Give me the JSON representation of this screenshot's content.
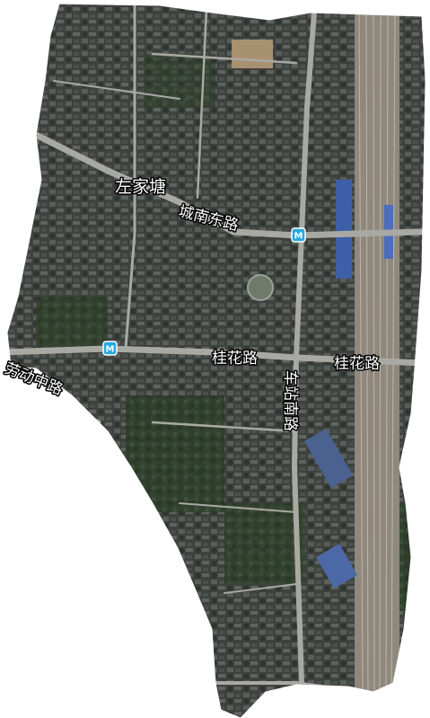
{
  "map": {
    "place_labels": [
      {
        "text": "左家塘"
      }
    ],
    "road_labels": [
      {
        "text": "城南东路"
      },
      {
        "text": "桂花路"
      },
      {
        "text": "桂花路"
      },
      {
        "text": "车站南路"
      },
      {
        "text": "劳动中路"
      }
    ],
    "metro_stations": [
      {
        "symbol": "M"
      },
      {
        "symbol": "M"
      }
    ],
    "colors": {
      "outside": "#ffffff",
      "urban_dense": "#3a3f3c",
      "urban_light": "#6b6e6a",
      "vegetation": "#2f4a2c",
      "road": "#a9a9a4",
      "railway": "#9d9688",
      "metro_badge": "#29a8e0"
    }
  }
}
